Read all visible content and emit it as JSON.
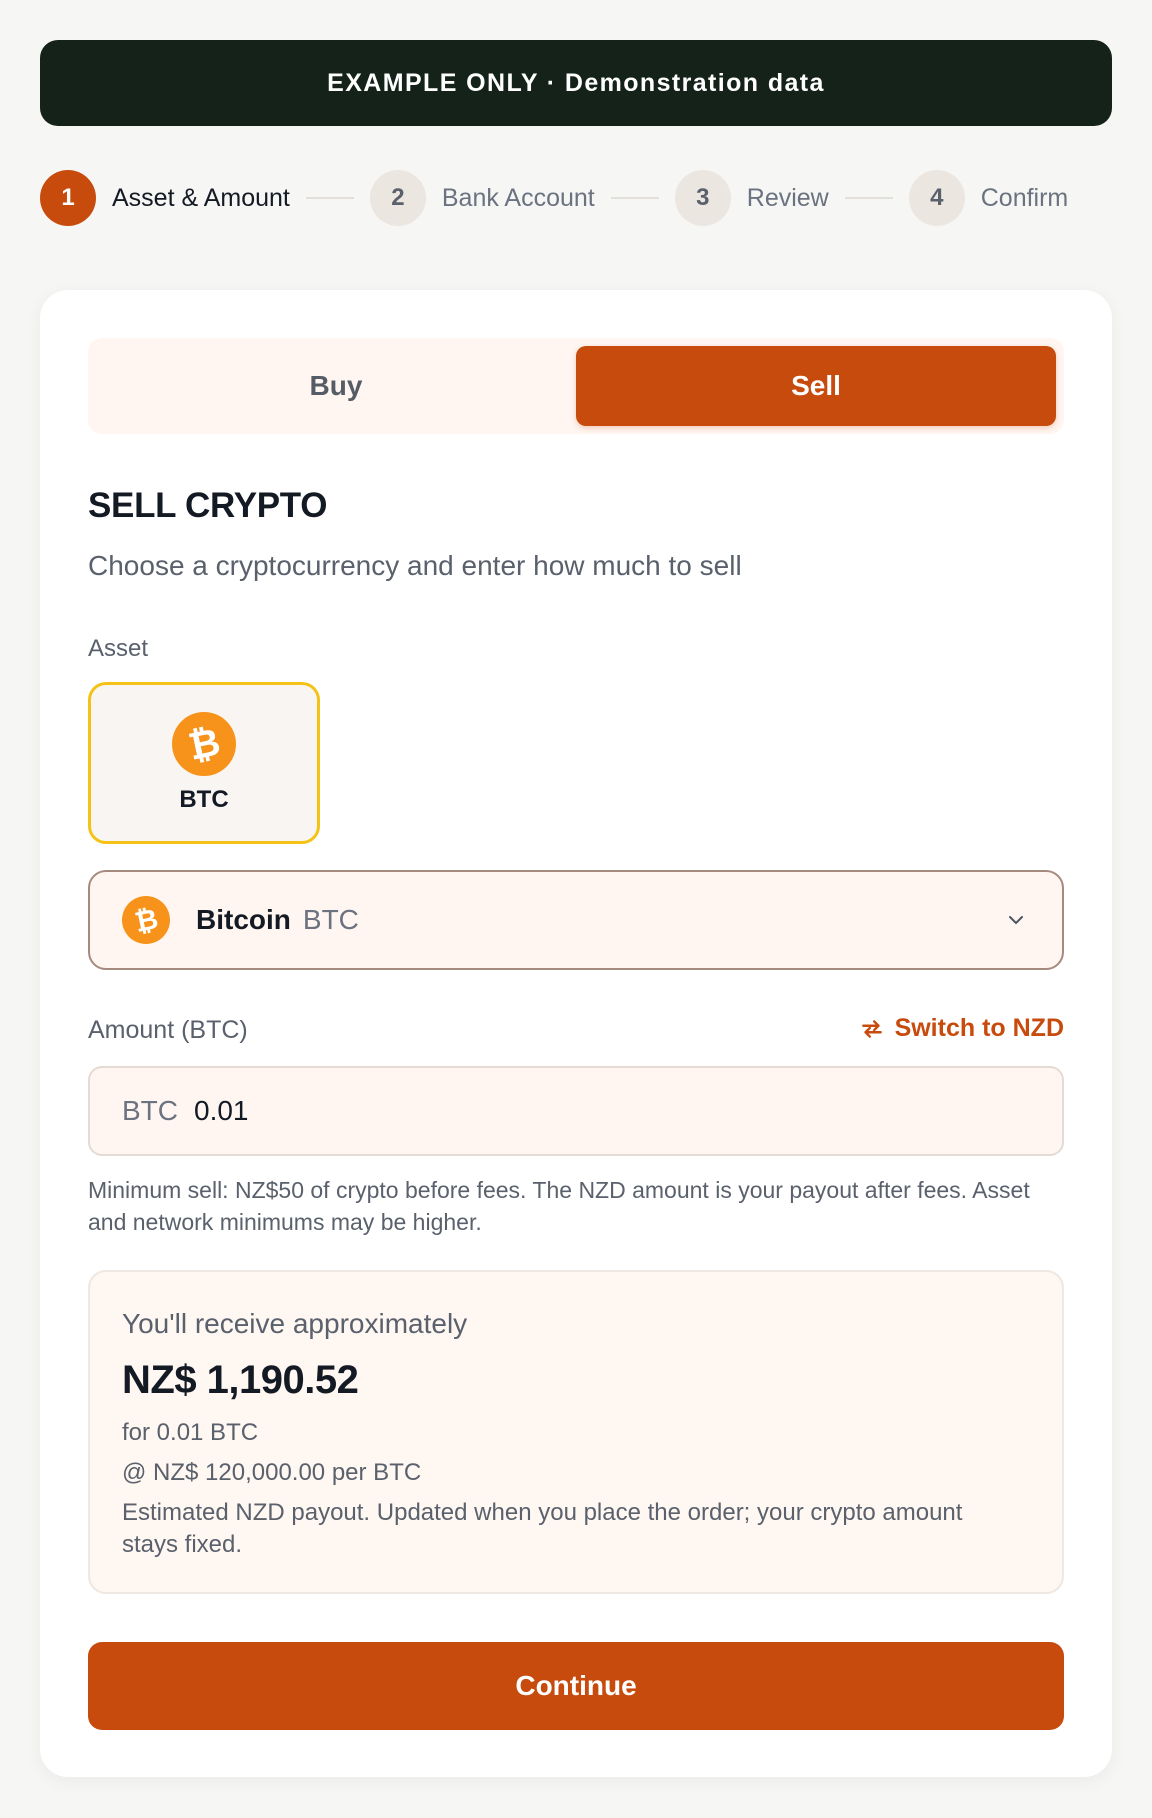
{
  "banner": {
    "text": "EXAMPLE ONLY · Demonstration data"
  },
  "stepper": {
    "steps": [
      {
        "num": "1",
        "label": "Asset & Amount",
        "active": true
      },
      {
        "num": "2",
        "label": "Bank Account",
        "active": false
      },
      {
        "num": "3",
        "label": "Review",
        "active": false
      },
      {
        "num": "4",
        "label": "Confirm",
        "active": false
      }
    ]
  },
  "mode_toggle": {
    "buy_label": "Buy",
    "sell_label": "Sell",
    "selected": "Sell"
  },
  "form": {
    "title": "SELL CRYPTO",
    "subtitle": "Choose a cryptocurrency and enter how much to sell",
    "asset_label": "Asset",
    "asset_tiles": [
      {
        "ticker": "BTC",
        "icon": "bitcoin-icon",
        "selected": true
      }
    ],
    "asset_select": {
      "name": "Bitcoin",
      "symbol": "BTC"
    },
    "amount_label": "Amount (BTC)",
    "switch_label": "Switch to NZD",
    "amount_prefix": "BTC",
    "amount_value": "0.01",
    "hint": "Minimum sell: NZ$50 of crypto before fees. The NZD amount is your payout after fees. Asset and network minimums may be higher."
  },
  "quote": {
    "label": "You'll receive approximately",
    "amount": "NZ$ 1,190.52",
    "for_text": "for 0.01 BTC",
    "rate": "@ NZ$ 120,000.00 per BTC",
    "note": "Estimated NZD payout. Updated when you place the order; your crypto amount stays fixed."
  },
  "continue_label": "Continue",
  "colors": {
    "accent": "#c84b0e",
    "banner_bg": "#142219",
    "bitcoin": "#f7931a",
    "selected_border": "#f5c218"
  }
}
